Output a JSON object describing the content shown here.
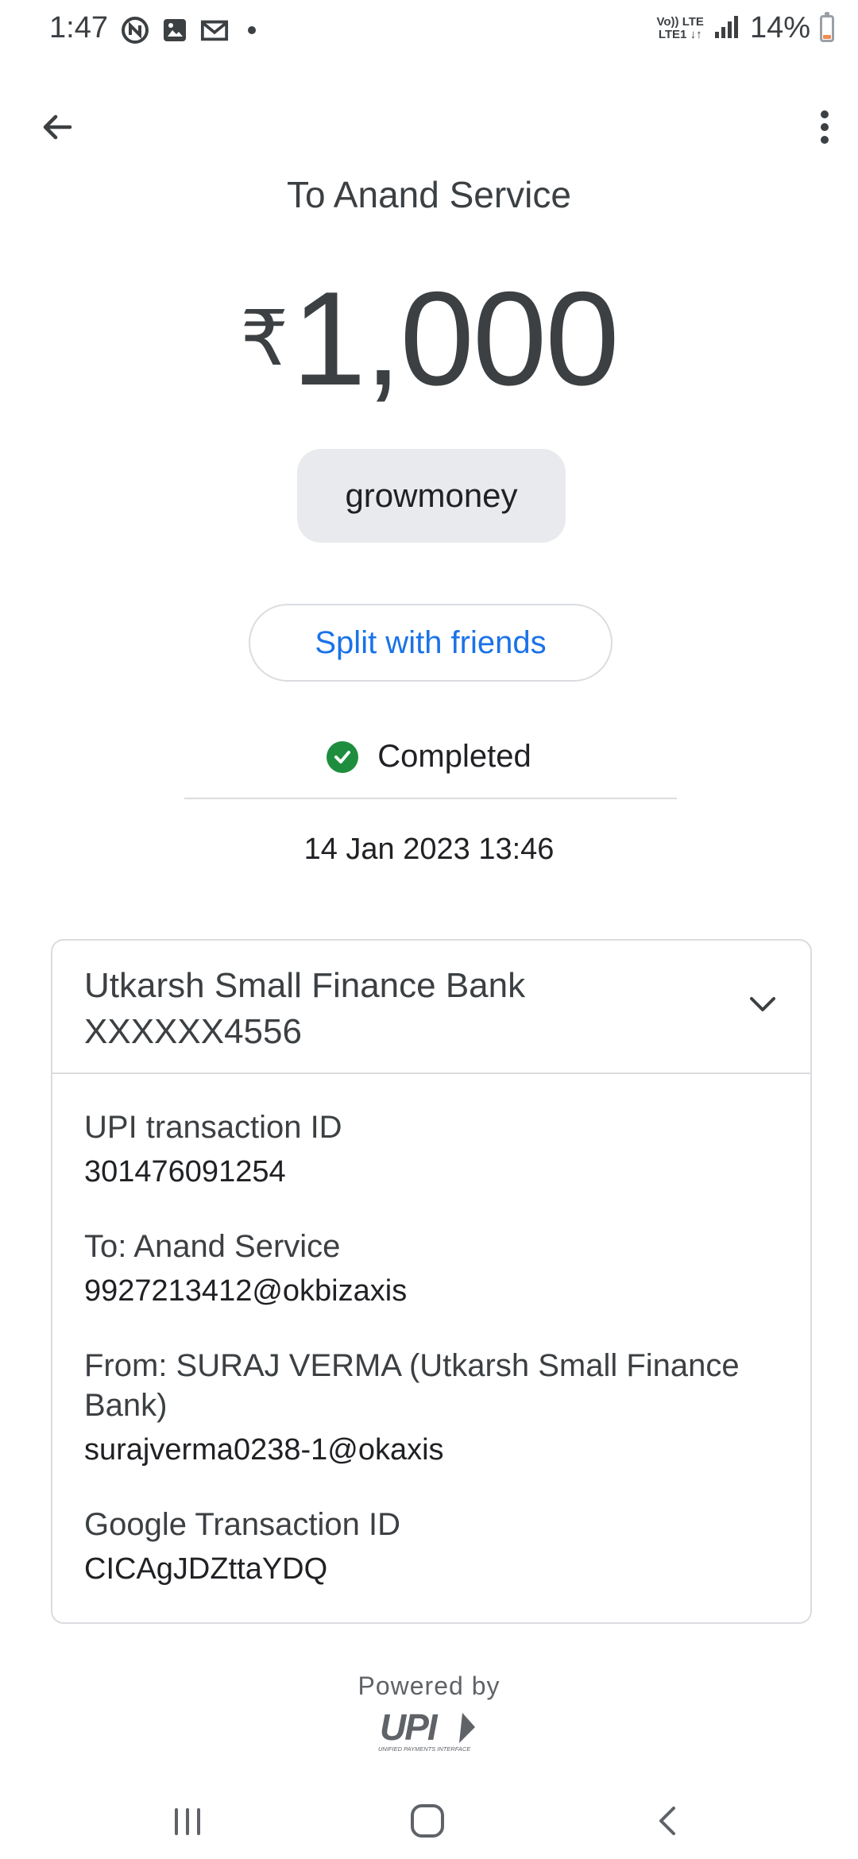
{
  "status_bar": {
    "time": "1:47",
    "network_top": "Vo)) LTE",
    "network_bottom": "LTE1 ↓↑",
    "battery_percent": "14%",
    "battery_level": 0.14
  },
  "header": {
    "to_title": "To Anand Service"
  },
  "payment": {
    "currency_symbol": "₹",
    "amount": "1,000",
    "note": "growmoney",
    "split_label": "Split with friends",
    "status": "Completed",
    "datetime": "14 Jan 2023 13:46"
  },
  "account_card": {
    "bank_name": "Utkarsh Small Finance Bank",
    "account_masked": "XXXXXX4556",
    "details": [
      {
        "label": "UPI transaction ID",
        "value": "301476091254"
      },
      {
        "label": "To: Anand Service",
        "value": "9927213412@okbizaxis"
      },
      {
        "label": "From: SURAJ  VERMA (Utkarsh Small Finance Bank)",
        "value": "surajverma0238-1@okaxis"
      },
      {
        "label": "Google Transaction ID",
        "value": "CICAgJDZttaYDQ"
      }
    ]
  },
  "footer": {
    "powered_by": "Powered by",
    "upi_wordmark": "UPI",
    "upi_subtitle": "UNIFIED PAYMENTS INTERFACE"
  },
  "colors": {
    "accent": "#1a73e8",
    "success": "#1e8e3e",
    "chip_bg": "#e8eaed",
    "border": "#dadce0"
  },
  "icons": {
    "back": "arrow-left-icon",
    "more": "more-vert-icon",
    "status": "check-circle-icon",
    "expand": "chevron-down-icon"
  }
}
